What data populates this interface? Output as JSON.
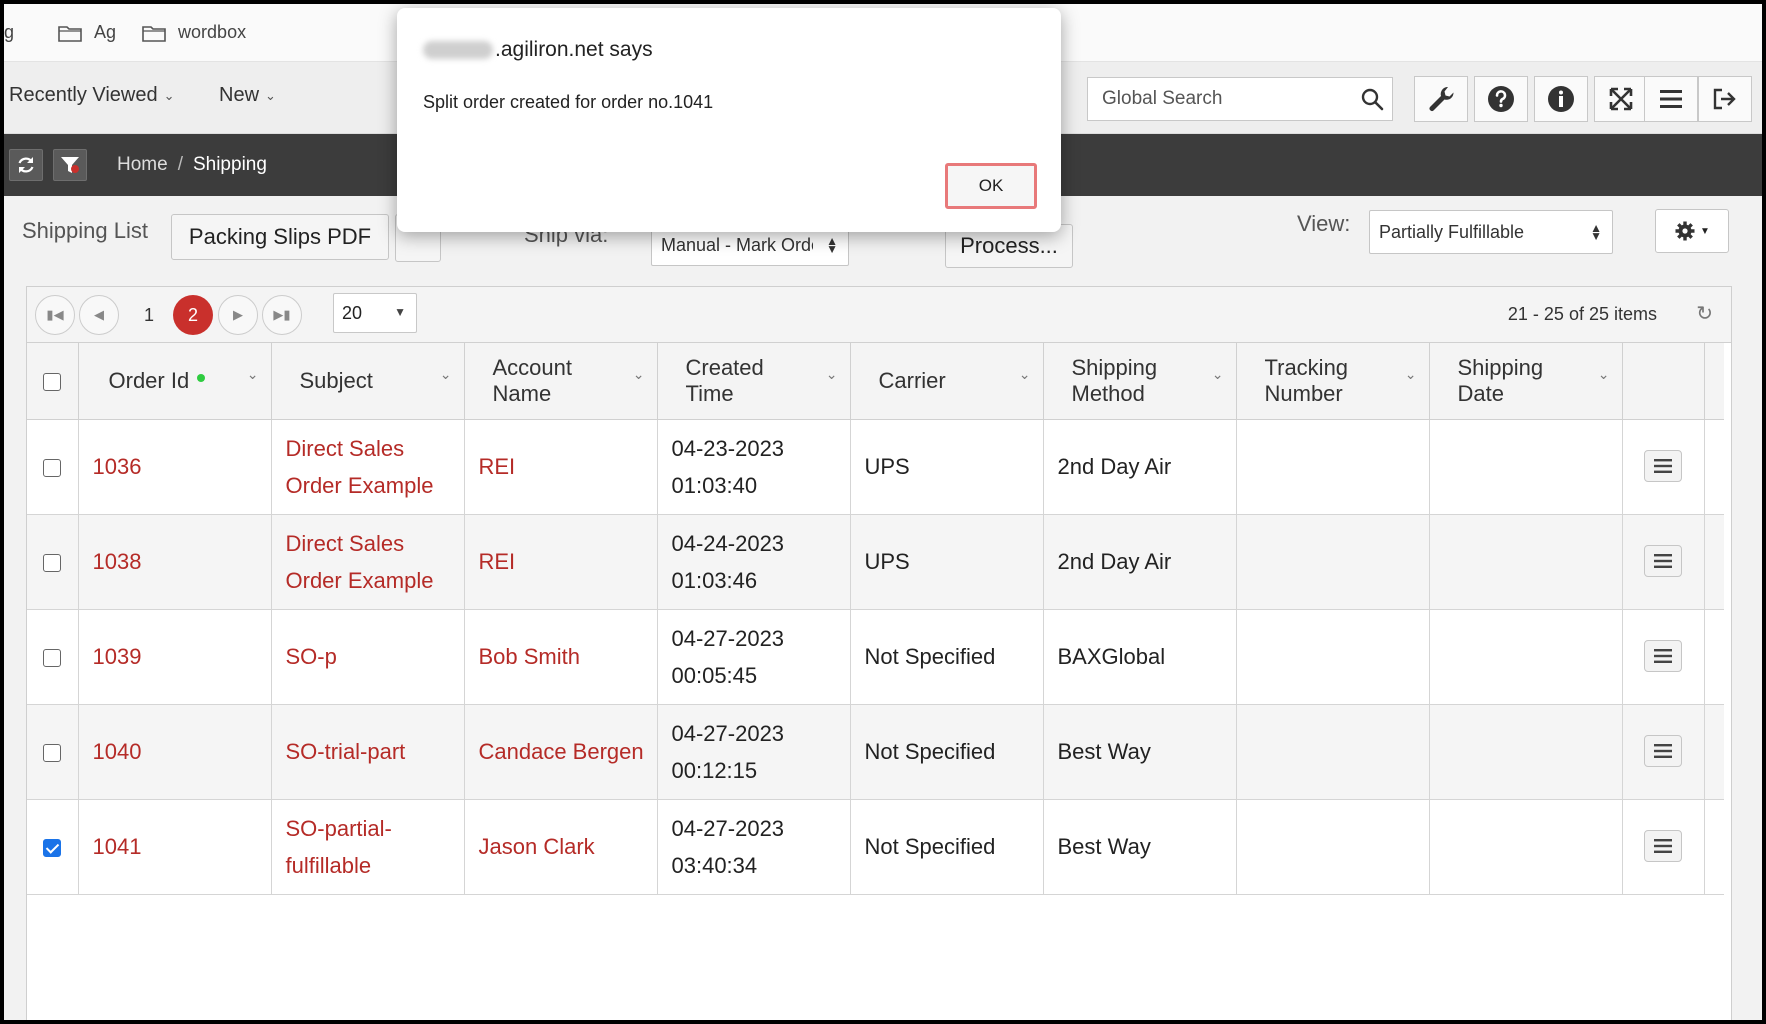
{
  "bookmarks": {
    "items": [
      {
        "label": "g",
        "icon": "none"
      },
      {
        "label": "Ag",
        "icon": "folder-icon"
      },
      {
        "label": "wordbox",
        "icon": "folder-icon"
      }
    ]
  },
  "header": {
    "recently_viewed": "Recently Viewed",
    "new_label": "New",
    "search_placeholder": "Global Search",
    "toolbar_icons": [
      "wrench-icon",
      "help-icon",
      "info-icon",
      "expand-icon",
      "menu-icon",
      "logout-icon"
    ]
  },
  "breadcrumb": {
    "home": "Home",
    "separator": "/",
    "current": "Shipping"
  },
  "toolbar": {
    "shipping_list_label": "Shipping List",
    "packing_slips_button": "Packing Slips PDF",
    "ship_via_label": "Ship via:",
    "ship_via_value": "Manual - Mark Order",
    "process_button": "Process...",
    "view_label": "View:",
    "view_value": "Partially Fulfillable"
  },
  "pager": {
    "pages": [
      "1",
      "2"
    ],
    "active_page": "2",
    "page_size": "20",
    "info": "21 - 25 of 25 items"
  },
  "table": {
    "columns": [
      {
        "label": "Order Id"
      },
      {
        "label": "Subject"
      },
      {
        "label": "Account Name"
      },
      {
        "label": "Created Time"
      },
      {
        "label": "Carrier"
      },
      {
        "label": "Shipping Method"
      },
      {
        "label": "Tracking Number"
      },
      {
        "label": "Shipping Date"
      }
    ],
    "rows": [
      {
        "checked": false,
        "order_id": "1036",
        "subject": "Direct Sales Order Example",
        "account": "REI",
        "created": "04-23-2023 01:03:40",
        "carrier": "UPS",
        "method": "2nd Day Air",
        "tracking": "",
        "ship_date": ""
      },
      {
        "checked": false,
        "order_id": "1038",
        "subject": "Direct Sales Order Example",
        "account": "REI",
        "created": "04-24-2023 01:03:46",
        "carrier": "UPS",
        "method": "2nd Day Air",
        "tracking": "",
        "ship_date": ""
      },
      {
        "checked": false,
        "order_id": "1039",
        "subject": "SO-p",
        "account": "Bob Smith",
        "created": "04-27-2023 00:05:45",
        "carrier": "Not Specified",
        "method": "BAXGlobal",
        "tracking": "",
        "ship_date": ""
      },
      {
        "checked": false,
        "order_id": "1040",
        "subject": "SO-trial-part",
        "account": "Candace Bergen",
        "created": "04-27-2023 00:12:15",
        "carrier": "Not Specified",
        "method": "Best Way",
        "tracking": "",
        "ship_date": ""
      },
      {
        "checked": true,
        "order_id": "1041",
        "subject": "SO-partial-fulfillable",
        "account": "Jason Clark",
        "created": "04-27-2023 03:40:34",
        "carrier": "Not Specified",
        "method": "Best Way",
        "tracking": "",
        "ship_date": ""
      }
    ]
  },
  "dialog": {
    "host": ".agiliron.net says",
    "message": "Split order created for order no.1041",
    "ok_label": "OK"
  },
  "colors": {
    "link": "#b52b27",
    "active_page": "#c9302c",
    "dark_bar": "#3c3c3c",
    "ok_highlight": "#e8797a"
  }
}
